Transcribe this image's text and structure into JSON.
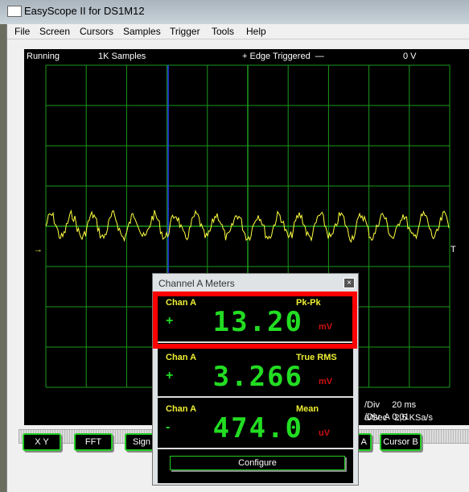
{
  "window": {
    "title": "EasyScope II for DS1M12"
  },
  "menu": [
    "File",
    "Screen",
    "Cursors",
    "Samples",
    "Trigger",
    "Tools",
    "Help"
  ],
  "status": {
    "run": "Running",
    "samples": "1K Samples",
    "trigger": "+ Edge Triggered  —",
    "level": "0 V"
  },
  "markers": {
    "left": "→",
    "right": "T"
  },
  "info": [
    "a/Sec   2,5 KSa/s",
    "/Div     20 ms",
    "/Div  A 0,01"
  ],
  "buttons": [
    "X Y",
    "FFT",
    "Sign",
    "A",
    "Cursor B"
  ],
  "dialog": {
    "title": "Channel A Meters",
    "close": "×",
    "configure": "Configure",
    "meters": [
      {
        "channel": "Chan A",
        "type": "Pk-Pk",
        "sign": "+",
        "value": "13.20",
        "unit": "mV"
      },
      {
        "channel": "Chan A",
        "type": "True RMS",
        "sign": "+",
        "value": "3.266",
        "unit": "mV"
      },
      {
        "channel": "Chan A",
        "type": "Mean",
        "sign": "-",
        "value": "474.0",
        "unit": "uV"
      }
    ]
  },
  "colors": {
    "grid": "#1a9a1a",
    "trace": "#ffff40",
    "cursor": "#2040ff",
    "digits": "#22dd22",
    "highlight": "#ff0000"
  }
}
